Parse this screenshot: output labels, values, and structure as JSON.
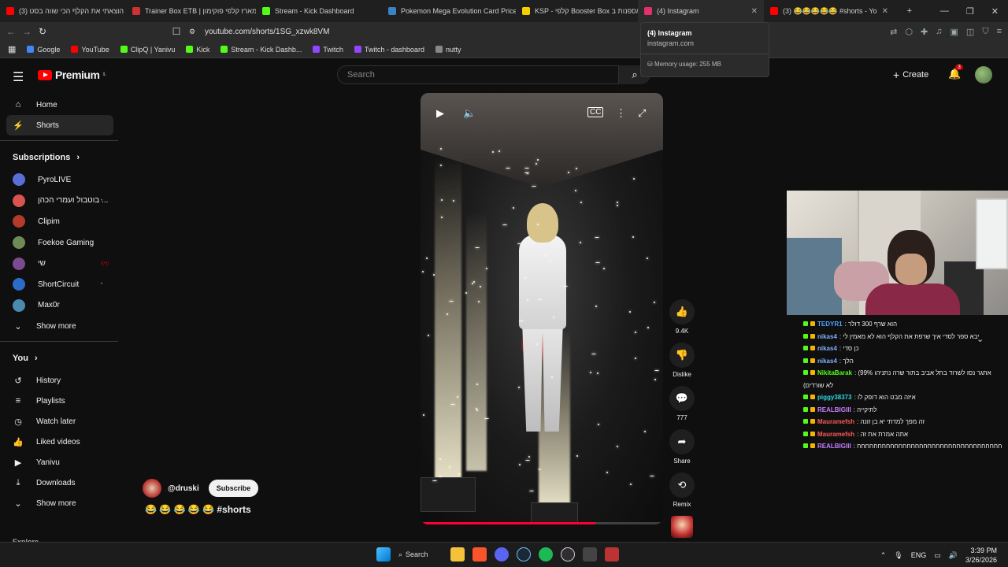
{
  "browser": {
    "tabs": [
      {
        "title": "(3) הוצאתי את הקלף הכי שווה בסט",
        "color": "#ff0000",
        "active": false
      },
      {
        "title": "Trainer Box ETB | מארז קלפי פוקימון",
        "color": "#c33",
        "active": false
      },
      {
        "title": "Stream - Kick Dashboard",
        "color": "#53fc18",
        "active": false
      },
      {
        "title": "Pokemon Mega Evolution Card Price",
        "color": "#3b82c4",
        "active": false
      },
      {
        "title": "KSP - קלפי Booster Box אספנות ב-",
        "color": "#f5d000",
        "active": false
      },
      {
        "title": "(4) Instagram",
        "color": "#e1306c",
        "active": true
      },
      {
        "title": "(3) 😂😂😂😂😂 #shorts - Yo",
        "color": "#ff0000",
        "active": false
      }
    ],
    "new_tab": "+",
    "window_controls": {
      "minimize": "—",
      "maximize": "❐",
      "close": "✕"
    },
    "url": "youtube.com/shorts/1SG_xzwk8VM",
    "bookmarks": [
      {
        "label": "Google",
        "color": "#4285f4"
      },
      {
        "label": "YouTube",
        "color": "#ff0000"
      },
      {
        "label": "ClipQ | Yanivu",
        "color": "#53fc18"
      },
      {
        "label": "Kick",
        "color": "#53fc18"
      },
      {
        "label": "Stream - Kick Dashb...",
        "color": "#53fc18"
      },
      {
        "label": "Twitch",
        "color": "#9146ff"
      },
      {
        "label": "Twitch - dashboard",
        "color": "#9146ff"
      },
      {
        "label": "nutty",
        "color": "#888888"
      }
    ],
    "tooltip": {
      "title": "(4) Instagram",
      "domain": "instagram.com",
      "memory": "Memory usage: 255 MB"
    }
  },
  "header": {
    "logo_text": "Premium",
    "logo_region": "IL",
    "search_placeholder": "Search",
    "create_label": "Create",
    "notification_count": "3"
  },
  "sidebar": {
    "main": [
      {
        "label": "Home",
        "icon": "home-icon",
        "glyph": "⌂",
        "active": false
      },
      {
        "label": "Shorts",
        "icon": "shorts-icon",
        "glyph": "⚡",
        "active": true
      }
    ],
    "subscriptions_title": "Subscriptions",
    "subscriptions": [
      {
        "label": "PyroLIVE",
        "color": "#5a6fd6",
        "dot": ""
      },
      {
        "label": "בוטבול ועמרי הכהן ...",
        "color": "#d9534f",
        "dot": "•"
      },
      {
        "label": "Clipim",
        "color": "#b43b2b",
        "dot": ""
      },
      {
        "label": "Foekoe Gaming",
        "color": "#6e8a55",
        "dot": ""
      },
      {
        "label": "שי",
        "color": "#7a4b8f",
        "dot": "((•))"
      },
      {
        "label": "ShortCircuit",
        "color": "#2c6cc9",
        "dot": "•"
      },
      {
        "label": "Max0r",
        "color": "#4a8ab0",
        "dot": ""
      }
    ],
    "show_more": "Show more",
    "you_title": "You",
    "you_items": [
      {
        "label": "History",
        "icon": "history-icon",
        "glyph": "↺"
      },
      {
        "label": "Playlists",
        "icon": "playlists-icon",
        "glyph": "≡"
      },
      {
        "label": "Watch later",
        "icon": "watch-later-icon",
        "glyph": "◷"
      },
      {
        "label": "Liked videos",
        "icon": "liked-icon",
        "glyph": "👍"
      },
      {
        "label": "Yanivu",
        "icon": "channel-icon",
        "glyph": "▶"
      },
      {
        "label": "Downloads",
        "icon": "downloads-icon",
        "glyph": "⤓"
      }
    ],
    "show_more_2": "Show more",
    "explore_title": "Explore"
  },
  "video": {
    "channel_handle": "@druski",
    "subscribe_label": "Subscribe",
    "caption": "😂 😂 😂 😂 😂 #shorts",
    "progress": 0.72
  },
  "actions": [
    {
      "name": "like-button",
      "glyph": "👍",
      "label": "9.4K"
    },
    {
      "name": "dislike-button",
      "glyph": "👎",
      "label": "Dislike"
    },
    {
      "name": "comments-button",
      "glyph": "💬",
      "label": "777"
    },
    {
      "name": "share-button",
      "glyph": "➦",
      "label": "Share"
    },
    {
      "name": "remix-button",
      "glyph": "⟲",
      "label": "Remix"
    }
  ],
  "chat": [
    {
      "user": "TEDYR1",
      "color": "#4da3ff",
      "msg": ": הוא שרף 300 דולר"
    },
    {
      "user": "nikas4",
      "color": "#7fb0ff",
      "msg": ": יבא ספר לסדי איך שרפת את הקלף הוא לא מאמין לי"
    },
    {
      "user": "nikas4",
      "color": "#7fb0ff",
      "msg": ": כן סדי"
    },
    {
      "user": "nikas4",
      "color": "#7fb0ff",
      "msg": ": הלך"
    },
    {
      "user": "NikitaBarak",
      "color": "#53fc18",
      "msg": ": (99% אתגר נסו לשרוד בתל אביב בתור שרה נתניהו"
    },
    {
      "user": "",
      "color": "#cccccc",
      "msg": "(לא שורדים"
    },
    {
      "user": "piggy38373",
      "color": "#2fd5e0",
      "msg": ": איזה מבט הוא דופק לו"
    },
    {
      "user": "REALBIGIII",
      "color": "#c77dff",
      "msg": ": לתיקייה"
    },
    {
      "user": "Mauramefsh",
      "color": "#ff5a5a",
      "msg": ": זה מפך למדתי יא בן זונה"
    },
    {
      "user": "Mauramefsh",
      "color": "#ff5a5a",
      "msg": ": אתה אמרת את זה"
    },
    {
      "user": "REALBIGIII",
      "color": "#c77dff",
      "msg": ": חחחחחחחחחחחחחחחחחחחחחחחחחחחחחחחחחחח"
    }
  ],
  "taskbar": {
    "search_label": "Search",
    "lang": "ENG",
    "time": "3:39 PM",
    "date": "3/26/2026"
  }
}
